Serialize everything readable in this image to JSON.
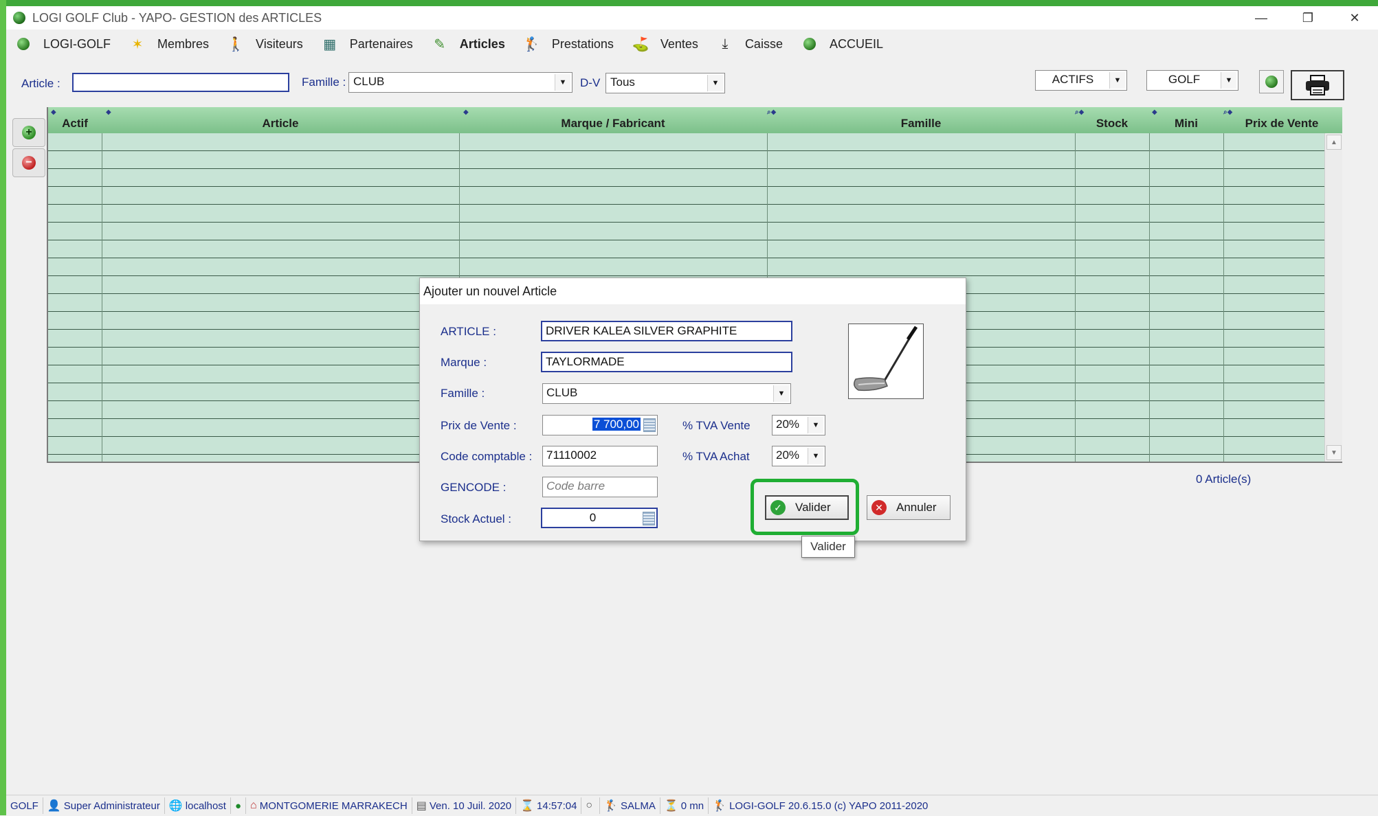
{
  "window": {
    "title": "LOGI GOLF Club - YAPO- GESTION des ARTICLES",
    "controls": {
      "minimize": "—",
      "restore": "❐",
      "close": "✕"
    }
  },
  "menu": [
    {
      "label": "LOGI-GOLF",
      "icon": "golf-ball-icon"
    },
    {
      "label": "Membres",
      "icon": "star-icon"
    },
    {
      "label": "Visiteurs",
      "icon": "walker-icon"
    },
    {
      "label": "Partenaires",
      "icon": "partners-icon"
    },
    {
      "label": "Articles",
      "icon": "pencil-icon"
    },
    {
      "label": "Prestations",
      "icon": "golfer-icon"
    },
    {
      "label": "Ventes",
      "icon": "cart-icon"
    },
    {
      "label": "Caisse",
      "icon": "download-icon"
    },
    {
      "label": "ACCUEIL",
      "icon": "home-ball-icon"
    }
  ],
  "filters": {
    "article_label": "Article :",
    "article_value": "",
    "famille_label": "Famille :",
    "famille_value": "CLUB",
    "dv_label": "D-V",
    "dv_value": "Tous",
    "actifs_value": "ACTIFS",
    "golf_value": "GOLF"
  },
  "grid": {
    "columns": [
      "Actif",
      "Article",
      "Marque / Fabricant",
      "Famille",
      "Stock",
      "Mini",
      "Prix de Vente"
    ],
    "rows": []
  },
  "count_label": "0 Article(s)",
  "dialog": {
    "title": "Ajouter un nouvel Article",
    "article_label": "ARTICLE :",
    "article_value": "DRIVER KALEA SILVER GRAPHITE",
    "marque_label": "Marque :",
    "marque_value": "TAYLORMADE",
    "famille_label": "Famille :",
    "famille_value": "CLUB",
    "prix_label": "Prix de Vente :",
    "prix_value": "7 700,00",
    "tva_vente_label": "% TVA  Vente",
    "tva_vente_value": "20%",
    "code_label": "Code comptable :",
    "code_value": "71110002",
    "tva_achat_label": "% TVA  Achat",
    "tva_achat_value": "20%",
    "gencode_label": "GENCODE :",
    "gencode_placeholder": "Code barre",
    "stock_label": "Stock Actuel :",
    "stock_value": "0",
    "valider_label": "Valider",
    "annuler_label": "Annuler",
    "tooltip": "Valider"
  },
  "status": {
    "module": "GOLF",
    "user": "Super Administrateur",
    "host": "localhost",
    "site": "MONTGOMERIE MARRAKECH",
    "date": "Ven. 10 Juil. 2020",
    "time": "14:57:04",
    "operator": "SALMA",
    "duration": "0 mn",
    "version": "LOGI-GOLF 20.6.15.0  (c) YAPO 2011-2020"
  },
  "colors": {
    "frame": "#5fc24a",
    "grid_header": "#8ecb9a",
    "grid_row": "#c8e4d6",
    "label_blue": "#1b2f8c",
    "highlight": "#1fae33"
  }
}
